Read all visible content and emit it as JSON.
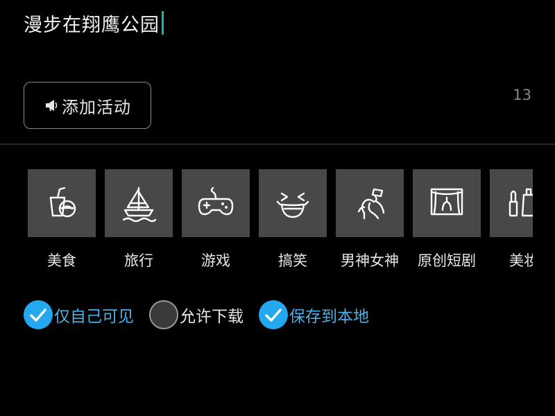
{
  "caption": {
    "text": "漫步在翔鹰公园",
    "cursor_color": "#1fb9a0"
  },
  "add_activity": {
    "label": "添加活动",
    "icon": "megaphone-icon"
  },
  "char_count": "13",
  "categories": [
    {
      "label": "美食",
      "icon": "food-bowl-icon"
    },
    {
      "label": "旅行",
      "icon": "sailboat-icon"
    },
    {
      "label": "游戏",
      "icon": "gamepad-icon"
    },
    {
      "label": "搞笑",
      "icon": "laughing-face-icon"
    },
    {
      "label": "男神女神",
      "icon": "dancer-icon"
    },
    {
      "label": "原创短剧",
      "icon": "theater-stage-icon"
    },
    {
      "label": "美妆",
      "icon": "cosmetics-icon"
    }
  ],
  "options": [
    {
      "label": "仅自己可见",
      "checked": true
    },
    {
      "label": "允许下载",
      "checked": false
    },
    {
      "label": "保存到本地",
      "checked": true
    }
  ],
  "colors": {
    "background": "#000000",
    "tile": "#484848",
    "accent": "#24a8ef",
    "accent_text": "#4dafe6"
  }
}
